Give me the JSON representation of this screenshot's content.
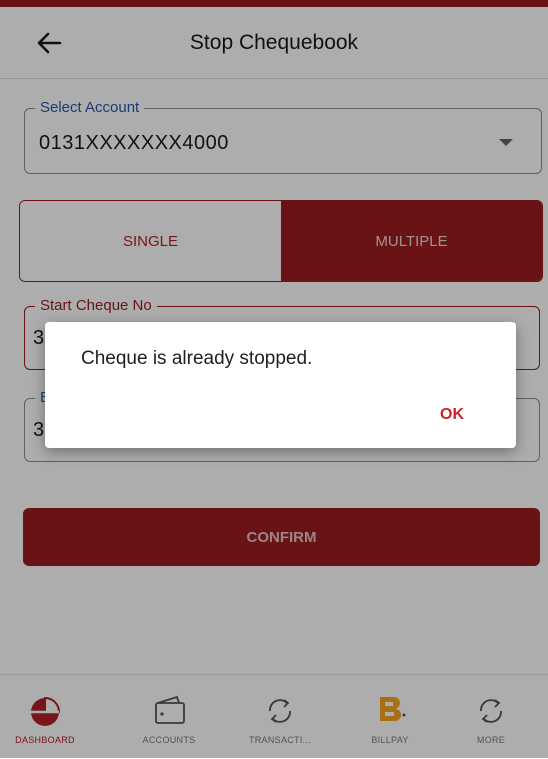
{
  "header": {
    "title": "Stop Chequebook",
    "back_icon": "arrow-left-icon"
  },
  "account": {
    "label": "Select Account",
    "value": "0131XXXXXXX4000"
  },
  "mode_toggle": {
    "options": [
      "SINGLE",
      "MULTIPLE"
    ],
    "selected": "MULTIPLE"
  },
  "start_cheque": {
    "label": "Start Cheque No",
    "value": "3"
  },
  "end_cheque": {
    "label": "E",
    "value": "3"
  },
  "confirm_label": "CONFIRM",
  "dialog": {
    "message": "Cheque is already stopped.",
    "ok_label": "OK"
  },
  "bottom_nav": [
    {
      "label": "DASHBOARD",
      "icon": "dashboard-icon",
      "active": true
    },
    {
      "label": "ACCOUNTS",
      "icon": "wallet-icon",
      "active": false
    },
    {
      "label": "TRANSACTI...",
      "icon": "sync-icon",
      "active": false
    },
    {
      "label": "BILLPAY",
      "icon": "billpay-logo-icon",
      "active": false
    },
    {
      "label": "MORE",
      "icon": "sync-icon",
      "active": false
    }
  ],
  "colors": {
    "brand_red": "#9c1c22",
    "accent_red": "#c8232c",
    "label_blue": "#2a5ba8",
    "billpay_orange": "#f5a623"
  }
}
